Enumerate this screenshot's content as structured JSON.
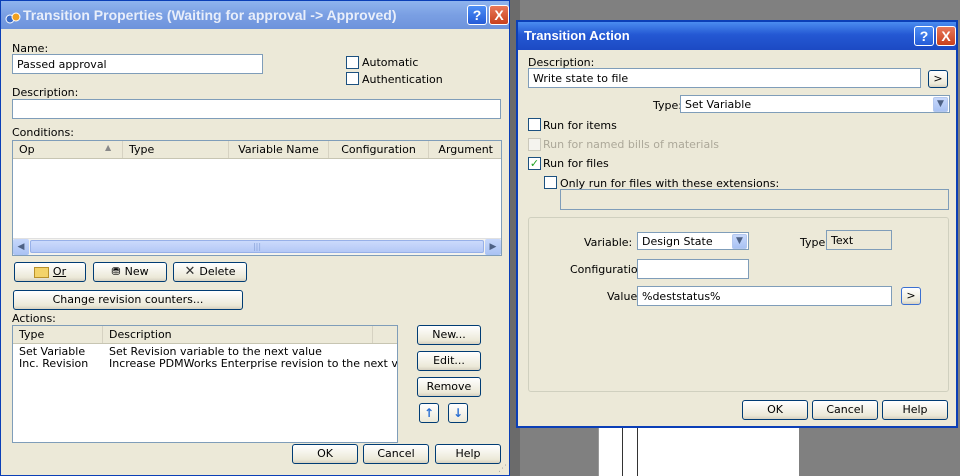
{
  "left_window": {
    "title": "Transition Properties (Waiting for approval -> Approved)",
    "name_label": "Name:",
    "name_value": "Passed approval",
    "automatic_label": "Automatic",
    "authentication_label": "Authentication",
    "description_label": "Description:",
    "description_value": "",
    "conditions_label": "Conditions:",
    "conditions_columns": [
      "Op",
      "Type",
      "Variable Name",
      "Configuration",
      "Argument"
    ],
    "or_button": "Or",
    "new_button": "New",
    "delete_button": "Delete",
    "change_revision_button": "Change revision counters...",
    "actions_label": "Actions:",
    "actions_columns": [
      "Type",
      "Description"
    ],
    "actions_rows": [
      {
        "type": "Set Variable",
        "description": "Set Revision variable to the next value"
      },
      {
        "type": "Inc. Revision",
        "description": "Increase PDMWorks Enterprise revision to the next value"
      }
    ],
    "action_new_button": "New...",
    "action_edit_button": "Edit...",
    "action_remove_button": "Remove",
    "ok_button": "OK",
    "cancel_button": "Cancel",
    "help_button": "Help"
  },
  "right_window": {
    "title": "Transition Action",
    "description_label": "Description:",
    "description_value": "Write state to file",
    "more_button": ">",
    "type_label": "Type:",
    "type_value": "Set Variable",
    "run_items_label": "Run for items",
    "run_items_checked": false,
    "run_bom_label": "Run for named bills of materials",
    "run_files_label": "Run for files",
    "run_files_checked": true,
    "only_ext_label": "Only run for files with these extensions:",
    "extensions_value": "",
    "variable_label": "Variable:",
    "variable_value": "Design State",
    "var_type_label": "Type:",
    "var_type_value": "Text",
    "configuration_label": "Configuration:",
    "configuration_value": "",
    "value_label": "Value:",
    "value_value": "%deststatus%",
    "value_more_button": ">",
    "ok_button": "OK",
    "cancel_button": "Cancel",
    "help_button": "Help"
  },
  "titlebar_help": "?",
  "titlebar_close": "X",
  "colors": {
    "xp_face": "#ece9d8",
    "title_active": "#2458d3",
    "title_inactive": "#7a9fe3",
    "check_green": "#21a121"
  }
}
